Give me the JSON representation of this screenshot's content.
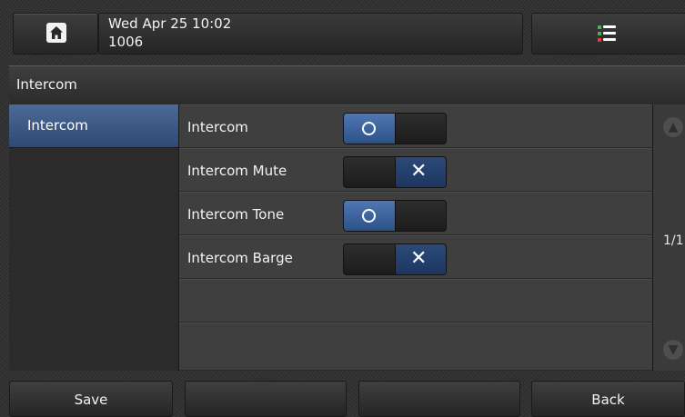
{
  "status": {
    "datetime": "Wed Apr 25 10:02",
    "extension": "1006"
  },
  "title": "Intercom",
  "sidebar": {
    "items": [
      {
        "label": "Intercom",
        "selected": true
      }
    ]
  },
  "settings": [
    {
      "label": "Intercom",
      "enabled": true
    },
    {
      "label": "Intercom Mute",
      "enabled": false
    },
    {
      "label": "Intercom Tone",
      "enabled": true
    },
    {
      "label": "Intercom Barge",
      "enabled": false
    }
  ],
  "pagination": "1/1",
  "softkeys": [
    "Save",
    "",
    "",
    "Back"
  ],
  "icons": {
    "home": "home-icon",
    "menu": "menu-list-icon",
    "scroll_up": "arrow-up-icon",
    "scroll_down": "arrow-down-icon",
    "toggle_on": "ring-icon",
    "toggle_off": "cross-icon"
  },
  "colors": {
    "selected_blue": "#3a5a8a",
    "toggle_on": "#4f77b3",
    "toggle_off": "#2c4a78",
    "menu_dot_green": "#4caf50",
    "menu_dot_red": "#e53935"
  }
}
